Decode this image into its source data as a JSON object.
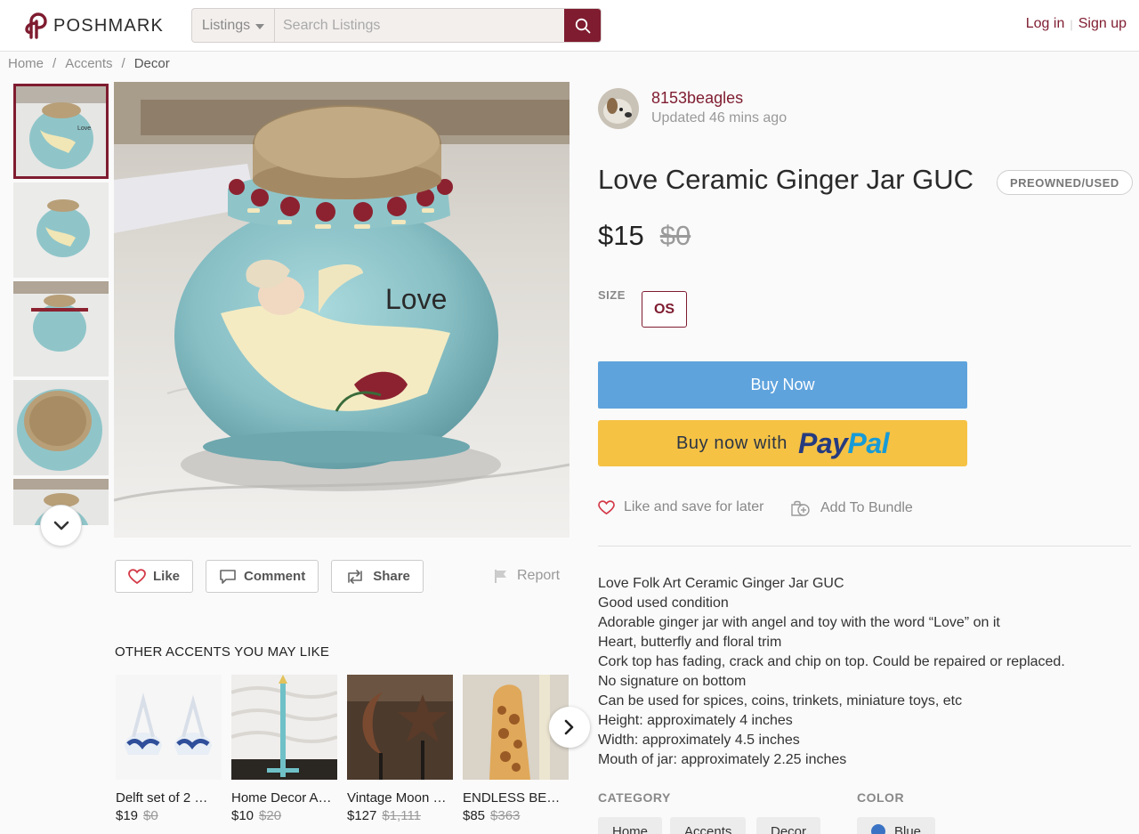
{
  "header": {
    "brand": "POSHMARK",
    "search_category": "Listings",
    "search_placeholder": "Search Listings",
    "login": "Log in",
    "divider": "|",
    "signup": "Sign up"
  },
  "breadcrumb": {
    "items": [
      "Home",
      "Accents",
      "Decor"
    ],
    "separator": "/"
  },
  "thumbnails": {
    "count_visible": 5,
    "active_index": 0
  },
  "actions": {
    "like": "Like",
    "comment": "Comment",
    "share": "Share",
    "report": "Report"
  },
  "other": {
    "title": "OTHER ACCENTS YOU MAY LIKE",
    "items": [
      {
        "name": "Delft set of 2 …",
        "price": "$19",
        "orig": "$0"
      },
      {
        "name": "Home Decor A…",
        "price": "$10",
        "orig": "$20"
      },
      {
        "name": "Vintage Moon …",
        "price": "$127",
        "orig": "$1,111"
      },
      {
        "name": "ENDLESS BEA…",
        "price": "$85",
        "orig": "$363"
      }
    ]
  },
  "listing": {
    "seller": "8153beagles",
    "updated": "Updated 46 mins ago",
    "title": "Love Ceramic Ginger Jar GUC",
    "condition": "PREOWNED/USED",
    "price": "$15",
    "original_price": "$0",
    "size_label": "SIZE",
    "size": "OS",
    "buy_now": "Buy Now",
    "paypal_prefix": "Buy now with",
    "paypal_pay": "Pay",
    "paypal_pal": "Pal",
    "like_save": "Like and save for later",
    "add_bundle": "Add To Bundle",
    "description": [
      "Love Folk Art Ceramic Ginger Jar GUC",
      "Good used condition",
      "Adorable ginger jar with angel and toy with the word “Love” on it",
      "Heart, butterfly and floral trim",
      "Cork top has fading, crack and chip on top. Could be repaired or replaced.",
      "No signature on bottom",
      "Can be used for spices, coins, trinkets, miniature toys, etc",
      "Height: approximately 4 inches",
      "Width: approximately 4.5 inches",
      "Mouth of jar: approximately 2.25 inches"
    ],
    "category_label": "CATEGORY",
    "categories": [
      "Home",
      "Accents",
      "Decor"
    ],
    "color_label": "COLOR",
    "color": "Blue",
    "jar_word": "Love"
  },
  "colors": {
    "brand": "#7f1c30",
    "buy_now": "#5fa3dd",
    "paypal_bg": "#f5c244",
    "jar": "#8fc5c9"
  }
}
